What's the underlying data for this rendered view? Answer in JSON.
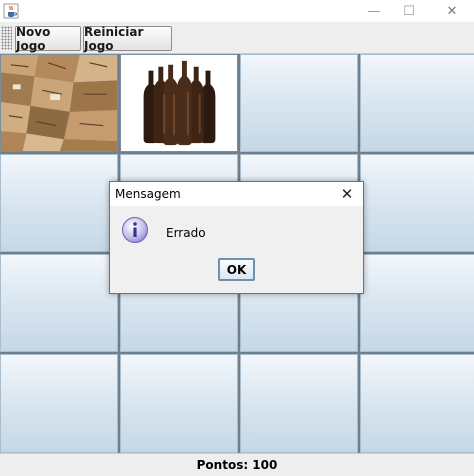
{
  "window": {
    "icon": "java-cup-icon",
    "controls": {
      "minimize": "—",
      "maximize": "☐",
      "close": "✕"
    }
  },
  "toolbar": {
    "new_game_label": "Novo Jogo",
    "restart_label": "Reiniciar Jogo"
  },
  "board": {
    "rows": 4,
    "columns": 4,
    "revealed_cards": [
      {
        "row": 1,
        "column": 1,
        "image": "cardboard-boxes"
      },
      {
        "row": 1,
        "column": 2,
        "image": "brown-glass-bottles"
      }
    ]
  },
  "status": {
    "score_text": "Pontos: 100"
  },
  "dialog": {
    "title": "Mensagem",
    "icon": "info-icon",
    "message": "Errado",
    "ok_label": "OK",
    "close_glyph": "✕"
  }
}
